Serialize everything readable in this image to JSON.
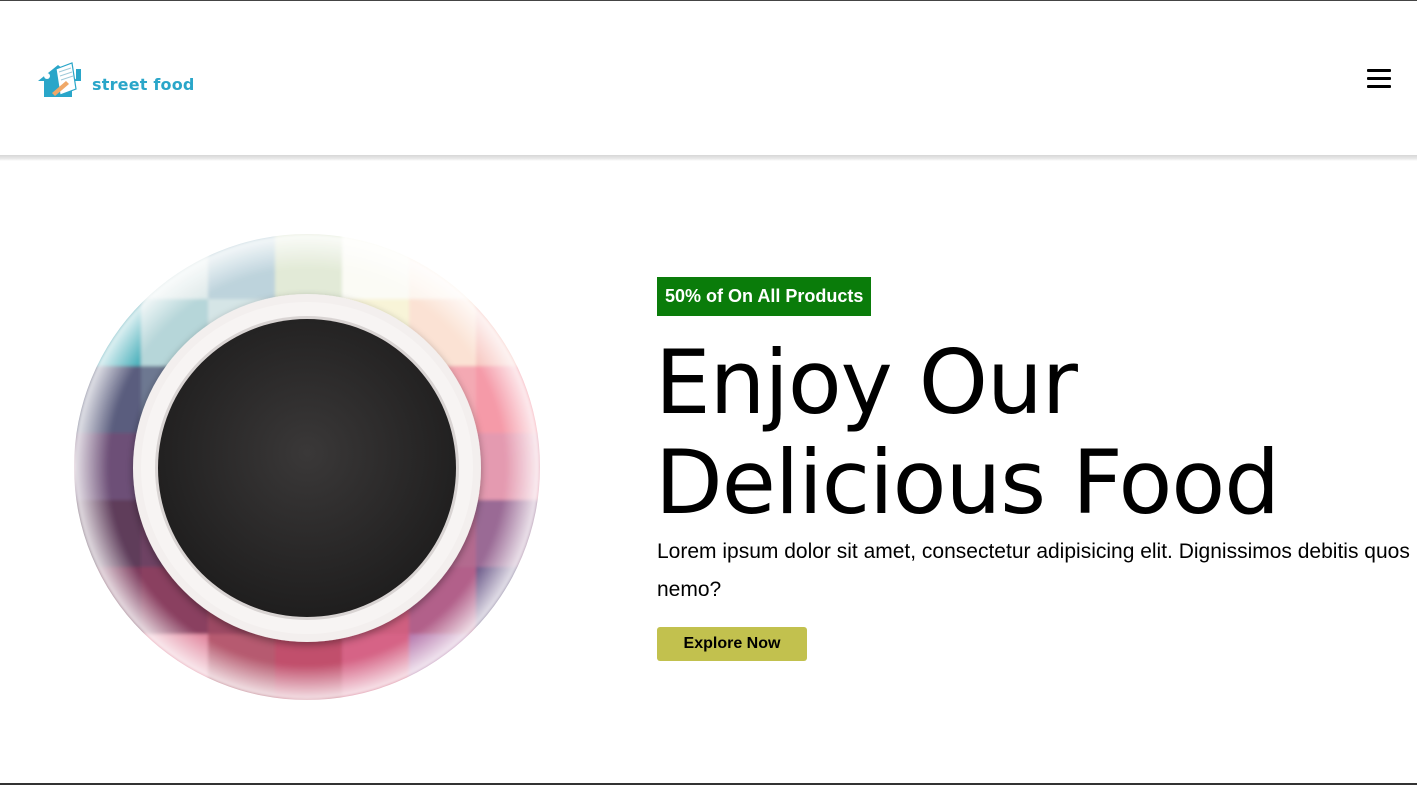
{
  "header": {
    "logo_text": "street food",
    "logo_icon": "house-with-pennant-icon",
    "menu_icon": "hamburger-menu-icon"
  },
  "hero": {
    "badge": "50% of On All Products",
    "title_line1": "Enjoy Our",
    "title_line2": "Delicious Food",
    "description": "Lorem ipsum dolor sit amet, consectetur adipisicing elit. Dignissimos debitis quos nemo?",
    "cta_label": "Explore Now",
    "image_icon": "plate-on-pixel-mosaic-image"
  },
  "colors": {
    "brand": "#2aa6c9",
    "badge_bg": "#0a7c0a",
    "cta_bg": "#c2c14e",
    "text": "#000000"
  }
}
